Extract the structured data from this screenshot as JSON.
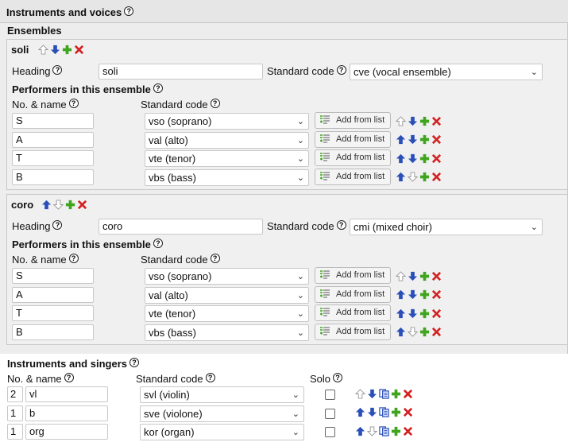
{
  "title": "Instruments and voices",
  "ensembles_label": "Ensembles",
  "help_glyph": "?",
  "ensembles": [
    {
      "name": "soli",
      "heading_label": "Heading",
      "heading_value": "soli",
      "std_code_label": "Standard code",
      "std_code_value": "cve (vocal ensemble)",
      "performers_label": "Performers in this ensemble",
      "col_name": "No. & name",
      "col_code": "Standard code",
      "performers": [
        {
          "name": "S",
          "code": "vso (soprano)",
          "add_label": "Add from list"
        },
        {
          "name": "A",
          "code": "val (alto)",
          "add_label": "Add from list"
        },
        {
          "name": "T",
          "code": "vte (tenor)",
          "add_label": "Add from list"
        },
        {
          "name": "B",
          "code": "vbs (bass)",
          "add_label": "Add from list"
        }
      ]
    },
    {
      "name": "coro",
      "heading_label": "Heading",
      "heading_value": "coro",
      "std_code_label": "Standard code",
      "std_code_value": "cmi (mixed choir)",
      "performers_label": "Performers in this ensemble",
      "col_name": "No. & name",
      "col_code": "Standard code",
      "performers": [
        {
          "name": "S",
          "code": "vso (soprano)",
          "add_label": "Add from list"
        },
        {
          "name": "A",
          "code": "val (alto)",
          "add_label": "Add from list"
        },
        {
          "name": "T",
          "code": "vte (tenor)",
          "add_label": "Add from list"
        },
        {
          "name": "B",
          "code": "vbs (bass)",
          "add_label": "Add from list"
        }
      ]
    }
  ],
  "instruments": {
    "label": "Instruments and singers",
    "col_name": "No. & name",
    "col_code": "Standard code",
    "col_solo": "Solo",
    "rows": [
      {
        "num": "2",
        "name": "vl",
        "code": "svl (violin)",
        "solo": false
      },
      {
        "num": "1",
        "name": "b",
        "code": "sve (violone)",
        "solo": false
      },
      {
        "num": "1",
        "name": "org",
        "code": "kor (organ)",
        "solo": false
      }
    ]
  },
  "colors": {
    "panel": "#ededed",
    "border": "#c8c8c8",
    "arrow_blue": "#2a4fb8",
    "plus_green": "#3fa51f",
    "delete_red": "#d42020"
  }
}
